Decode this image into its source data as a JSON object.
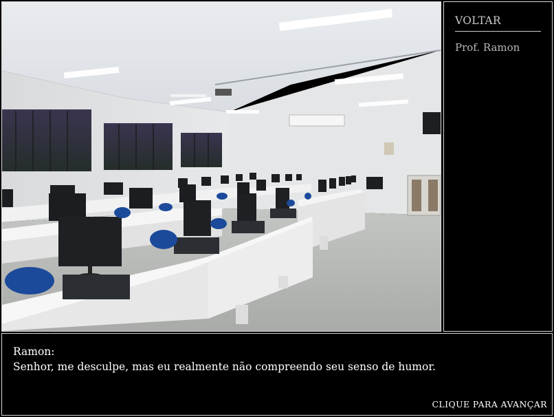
{
  "menu": {
    "back_label": "VOLTAR",
    "character_name": "Prof. Ramon"
  },
  "dialog": {
    "speaker": "Ramon:",
    "text": "Senhor, me desculpe, mas eu realmente não compreendo seu senso de humor.",
    "advance_label": "CLIQUE PARA AVANÇAR"
  }
}
